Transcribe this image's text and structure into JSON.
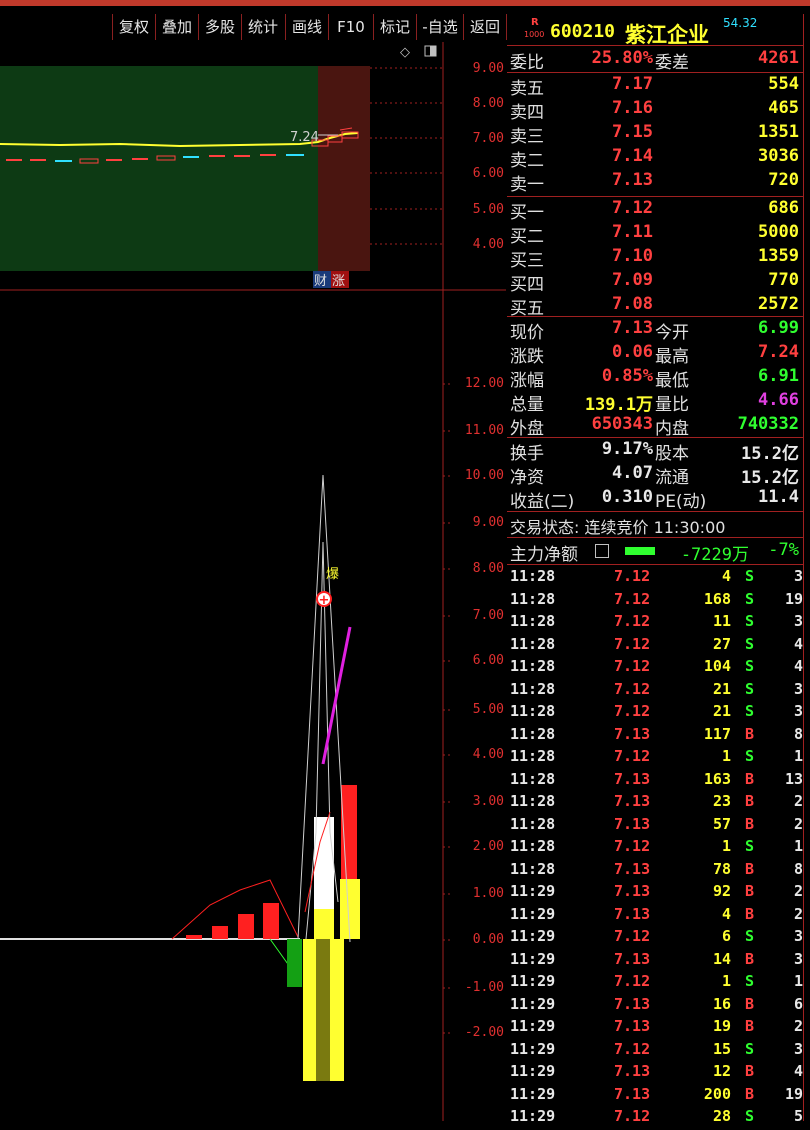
{
  "toolbar": {
    "buttons": [
      "复权",
      "叠加",
      "多股",
      "统计",
      "画线",
      "F10",
      "标记",
      "-自选",
      "返回"
    ]
  },
  "stock": {
    "badge_top": "R",
    "badge_bottom": "1000",
    "code": "600210",
    "name": "紫江企业",
    "corner_value": "54.32"
  },
  "upper_panel": {
    "y_ticks": [
      "9.00",
      "8.00",
      "7.00",
      "6.00",
      "5.00",
      "4.00"
    ],
    "price_label": "7.24",
    "badges": [
      "财",
      "涨"
    ]
  },
  "lower_panel": {
    "y_ticks": [
      "12.00",
      "11.00",
      "10.00",
      "9.00",
      "8.00",
      "7.00",
      "6.00",
      "5.00",
      "4.00",
      "3.00",
      "2.00",
      "1.00",
      "0.00",
      "-1.00",
      "-2.00"
    ],
    "marker_label": "爆"
  },
  "order_book": {
    "weibi_label": "委比",
    "weibi_value": "25.80%",
    "weicha_label": "委差",
    "weicha_value": "4261",
    "sells": [
      {
        "label": "卖五",
        "price": "7.17",
        "vol": "554"
      },
      {
        "label": "卖四",
        "price": "7.16",
        "vol": "465"
      },
      {
        "label": "卖三",
        "price": "7.15",
        "vol": "1351"
      },
      {
        "label": "卖二",
        "price": "7.14",
        "vol": "3036"
      },
      {
        "label": "卖一",
        "price": "7.13",
        "vol": "720"
      }
    ],
    "buys": [
      {
        "label": "买一",
        "price": "7.12",
        "vol": "686"
      },
      {
        "label": "买二",
        "price": "7.11",
        "vol": "5000"
      },
      {
        "label": "买三",
        "price": "7.10",
        "vol": "1359"
      },
      {
        "label": "买四",
        "price": "7.09",
        "vol": "770"
      },
      {
        "label": "买五",
        "price": "7.08",
        "vol": "2572"
      }
    ]
  },
  "stats": [
    {
      "l1": "现价",
      "v1": "7.13",
      "c1": "red",
      "l2": "今开",
      "v2": "6.99",
      "c2": "green"
    },
    {
      "l1": "涨跌",
      "v1": "0.06",
      "c1": "red",
      "l2": "最高",
      "v2": "7.24",
      "c2": "red"
    },
    {
      "l1": "涨幅",
      "v1": "0.85%",
      "c1": "red",
      "l2": "最低",
      "v2": "6.91",
      "c2": "green"
    },
    {
      "l1": "总量",
      "v1": "139.1万",
      "c1": "yellow",
      "l2": "量比",
      "v2": "4.66",
      "c2": "magenta"
    },
    {
      "l1": "外盘",
      "v1": "650343",
      "c1": "red",
      "l2": "内盘",
      "v2": "740332",
      "c2": "green"
    }
  ],
  "stats2": [
    {
      "l1": "换手",
      "v1": "9.17%",
      "l2": "股本",
      "v2": "15.2亿"
    },
    {
      "l1": "净资",
      "v1": "4.07",
      "l2": "流通",
      "v2": "15.2亿"
    },
    {
      "l1": "收益(二)",
      "v1": "0.310",
      "l2": "PE(动)",
      "v2": "11.4"
    }
  ],
  "trade_status": "交易状态: 连续竞价 11:30:00",
  "main_flow": {
    "label": "主力净额",
    "value": "-7229万",
    "pct": "-7%"
  },
  "ticks": [
    {
      "t": "11:28",
      "p": "7.12",
      "v": "4",
      "d": "S",
      "n": "3"
    },
    {
      "t": "11:28",
      "p": "7.12",
      "v": "168",
      "d": "S",
      "n": "19"
    },
    {
      "t": "11:28",
      "p": "7.12",
      "v": "11",
      "d": "S",
      "n": "3"
    },
    {
      "t": "11:28",
      "p": "7.12",
      "v": "27",
      "d": "S",
      "n": "4"
    },
    {
      "t": "11:28",
      "p": "7.12",
      "v": "104",
      "d": "S",
      "n": "4"
    },
    {
      "t": "11:28",
      "p": "7.12",
      "v": "21",
      "d": "S",
      "n": "3"
    },
    {
      "t": "11:28",
      "p": "7.12",
      "v": "21",
      "d": "S",
      "n": "3"
    },
    {
      "t": "11:28",
      "p": "7.13",
      "v": "117",
      "d": "B",
      "n": "8"
    },
    {
      "t": "11:28",
      "p": "7.12",
      "v": "1",
      "d": "S",
      "n": "1"
    },
    {
      "t": "11:28",
      "p": "7.13",
      "v": "163",
      "d": "B",
      "n": "13"
    },
    {
      "t": "11:28",
      "p": "7.13",
      "v": "23",
      "d": "B",
      "n": "2"
    },
    {
      "t": "11:28",
      "p": "7.13",
      "v": "57",
      "d": "B",
      "n": "2"
    },
    {
      "t": "11:28",
      "p": "7.12",
      "v": "1",
      "d": "S",
      "n": "1"
    },
    {
      "t": "11:28",
      "p": "7.13",
      "v": "78",
      "d": "B",
      "n": "8"
    },
    {
      "t": "11:29",
      "p": "7.13",
      "v": "92",
      "d": "B",
      "n": "2"
    },
    {
      "t": "11:29",
      "p": "7.13",
      "v": "4",
      "d": "B",
      "n": "2"
    },
    {
      "t": "11:29",
      "p": "7.12",
      "v": "6",
      "d": "S",
      "n": "3"
    },
    {
      "t": "11:29",
      "p": "7.13",
      "v": "14",
      "d": "B",
      "n": "3"
    },
    {
      "t": "11:29",
      "p": "7.12",
      "v": "1",
      "d": "S",
      "n": "1"
    },
    {
      "t": "11:29",
      "p": "7.13",
      "v": "16",
      "d": "B",
      "n": "6"
    },
    {
      "t": "11:29",
      "p": "7.13",
      "v": "19",
      "d": "B",
      "n": "2"
    },
    {
      "t": "11:29",
      "p": "7.12",
      "v": "15",
      "d": "S",
      "n": "3"
    },
    {
      "t": "11:29",
      "p": "7.13",
      "v": "12",
      "d": "B",
      "n": "4"
    },
    {
      "t": "11:29",
      "p": "7.13",
      "v": "200",
      "d": "B",
      "n": "19"
    },
    {
      "t": "11:29",
      "p": "7.12",
      "v": "28",
      "d": "S",
      "n": "5"
    }
  ]
}
